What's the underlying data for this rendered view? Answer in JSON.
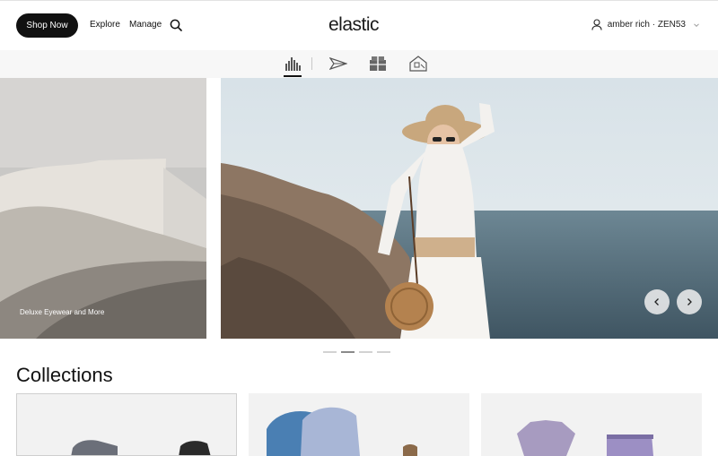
{
  "header": {
    "shop_button": "Shop Now",
    "nav": {
      "explore": "Explore",
      "manage": "Manage"
    },
    "logo": "elastic",
    "user": "amber rich · ZEN53"
  },
  "categories": [
    {
      "icon": "skyline-icon",
      "active": true
    },
    {
      "icon": "paper-plane-icon",
      "active": false
    },
    {
      "icon": "gift-box-icon",
      "active": false
    },
    {
      "icon": "house-icon",
      "active": false
    }
  ],
  "hero": {
    "caption": "Deluxe Eyewear and More",
    "slide_count": 4,
    "active_slide": 2
  },
  "collections": {
    "title": "Collections",
    "cards": [
      {
        "subject": "shoes"
      },
      {
        "subject": "backpacks"
      },
      {
        "subject": "apparel"
      }
    ]
  },
  "colors": {
    "primary": "#111111",
    "strip_bg": "#f7f7f7",
    "dot_active": "#8a8a8a",
    "dot_inactive": "#d2d2d2"
  }
}
